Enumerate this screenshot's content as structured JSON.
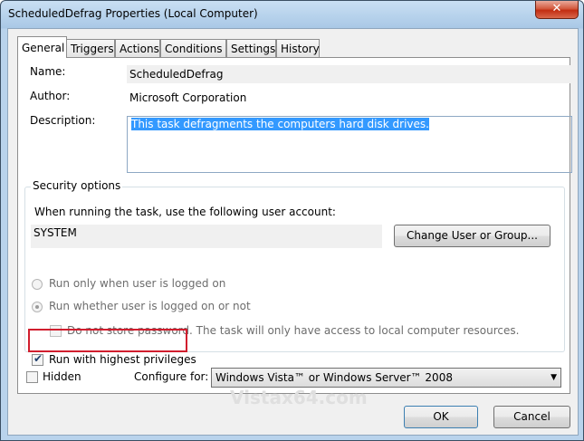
{
  "window": {
    "title": "ScheduledDefrag Properties (Local Computer)",
    "close_glyph": "✕"
  },
  "tabs": [
    "General",
    "Triggers",
    "Actions",
    "Conditions",
    "Settings",
    "History"
  ],
  "general": {
    "name_label": "Name:",
    "name_value": "ScheduledDefrag",
    "author_label": "Author:",
    "author_value": "Microsoft Corporation",
    "description_label": "Description:",
    "description_value": "This task defragments the computers hard disk drives."
  },
  "security": {
    "legend": "Security options",
    "account_prompt": "When running the task, use the following user account:",
    "account_value": "SYSTEM",
    "change_button": "Change User or Group...",
    "radio_logged_on": "Run only when user is logged on",
    "radio_whether": "Run whether user is logged on or not",
    "radio_selected": "whether",
    "do_not_store": "Do not store password.  The task will only have access to local computer resources.",
    "do_not_store_checked": false,
    "highest_privileges": "Run with highest privileges",
    "highest_privileges_checked": true
  },
  "footer": {
    "hidden_label": "Hidden",
    "hidden_checked": false,
    "configure_label": "Configure for:",
    "configure_value": "Windows Vista™ or Windows Server™ 2008",
    "ok_button": "OK",
    "cancel_button": "Cancel"
  },
  "watermark": "Vistax64.com",
  "colors": {
    "highlight_red": "#d11e2e",
    "selection_blue": "#3399ff"
  }
}
